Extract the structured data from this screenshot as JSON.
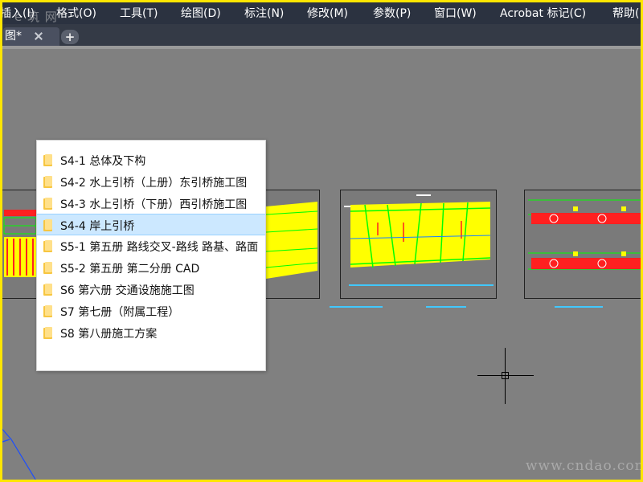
{
  "menubar": {
    "items": [
      {
        "label": "插入(I)"
      },
      {
        "label": "格式(O)"
      },
      {
        "label": "工具(T)"
      },
      {
        "label": "绘图(D)"
      },
      {
        "label": "标注(N)"
      },
      {
        "label": "修改(M)"
      },
      {
        "label": "参数(P)"
      },
      {
        "label": "窗口(W)"
      },
      {
        "label": "Acrobat 标记(C)"
      },
      {
        "label": "帮助("
      }
    ],
    "watermark": "e 筑 网"
  },
  "tabs": {
    "doc_tab_label": "图*",
    "add_label": "+"
  },
  "folder_list": {
    "selected_index": 3,
    "items": [
      {
        "label": "S4-1 总体及下构"
      },
      {
        "label": "S4-2 水上引桥（上册）东引桥施工图"
      },
      {
        "label": "S4-3 水上引桥（下册）西引桥施工图"
      },
      {
        "label": "S4-4 岸上引桥"
      },
      {
        "label": "S5-1 第五册  路线交叉-路线 路基、路面"
      },
      {
        "label": "S5-2 第五册 第二分册 CAD"
      },
      {
        "label": "S6 第六册 交通设施施工图"
      },
      {
        "label": "S7 第七册（附属工程）"
      },
      {
        "label": "S8 第八册施工方案"
      }
    ]
  },
  "colors": {
    "menubar_bg": "#2b3240",
    "canvas_bg": "#808080",
    "selection_bg": "#cce8ff",
    "drawing_yellow": "#ffff00",
    "drawing_green": "#00ff00",
    "drawing_red": "#ff2020",
    "frame_border": "#ffe600"
  },
  "watermark_bottom": "www.cndao.com"
}
